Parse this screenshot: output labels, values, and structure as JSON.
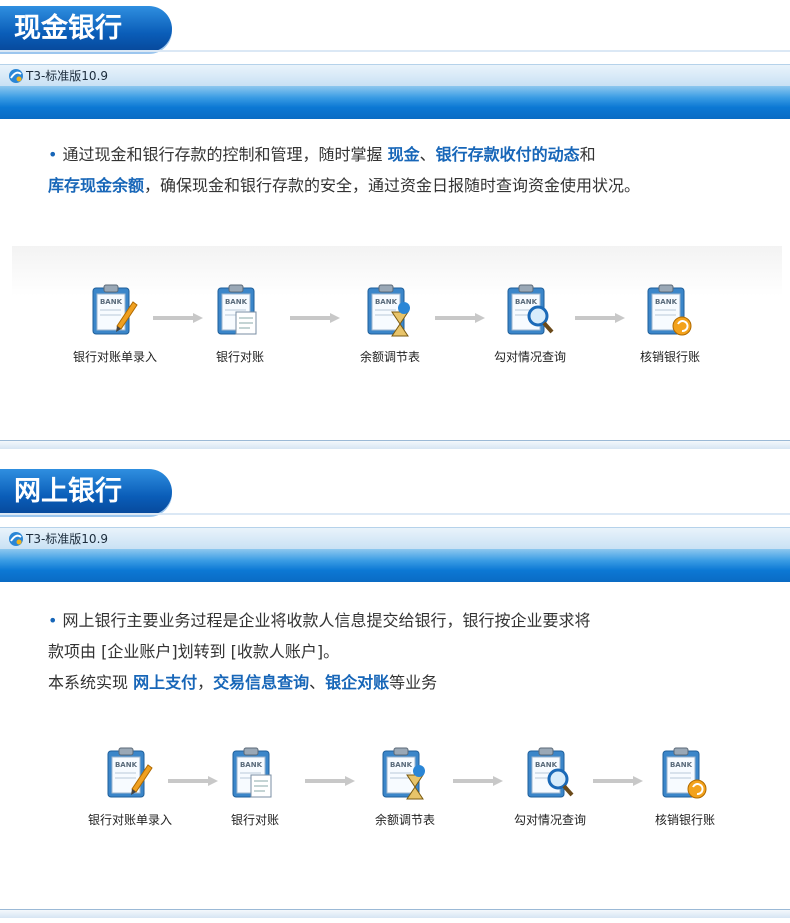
{
  "sections": [
    {
      "heading": "现金银行",
      "app_title": "T3-标准版10.9",
      "desc": {
        "bullet": "•",
        "parts": [
          "通过现金和银行存款的控制和管理，随时掌握 ",
          "现金",
          "、",
          "银行存款收付的动态",
          "和",
          "库存现金余额",
          "，确保现金和银行存款的安全，通过资金日报随时查询资金使用状况。"
        ]
      },
      "steps": [
        {
          "label": "银行对账单录入",
          "icon": "clipboard-pen-icon"
        },
        {
          "label": "银行对账",
          "icon": "clipboard-docs-icon"
        },
        {
          "label": "余额调节表",
          "icon": "clipboard-hourglass-icon"
        },
        {
          "label": "勾对情况查询",
          "icon": "clipboard-magnifier-icon"
        },
        {
          "label": "核销银行账",
          "icon": "clipboard-refresh-icon"
        }
      ]
    },
    {
      "heading": "网上银行",
      "app_title": "T3-标准版10.9",
      "desc": {
        "bullet": "•",
        "line1": "网上银行主要业务过程是企业将收款人信息提交给银行，银行按企业要求将",
        "line2": "款项由 [企业账户]划转到 [收款人账户]。",
        "line3_parts": [
          "本系统实现 ",
          "网上支付",
          "，",
          "交易信息查询",
          "、",
          "银企对账",
          "等业务"
        ]
      },
      "steps": [
        {
          "label": "银行对账单录入",
          "icon": "clipboard-pen-icon"
        },
        {
          "label": "银行对账",
          "icon": "clipboard-docs-icon"
        },
        {
          "label": "余额调节表",
          "icon": "clipboard-hourglass-icon"
        },
        {
          "label": "勾对情况查询",
          "icon": "clipboard-magnifier-icon"
        },
        {
          "label": "核销银行账",
          "icon": "clipboard-refresh-icon"
        }
      ]
    }
  ],
  "icon_badge_text": "BANK",
  "colors": {
    "accent": "#1766b8",
    "ribbon": "#0c78d4",
    "heading_bg": "#0a5db8"
  }
}
